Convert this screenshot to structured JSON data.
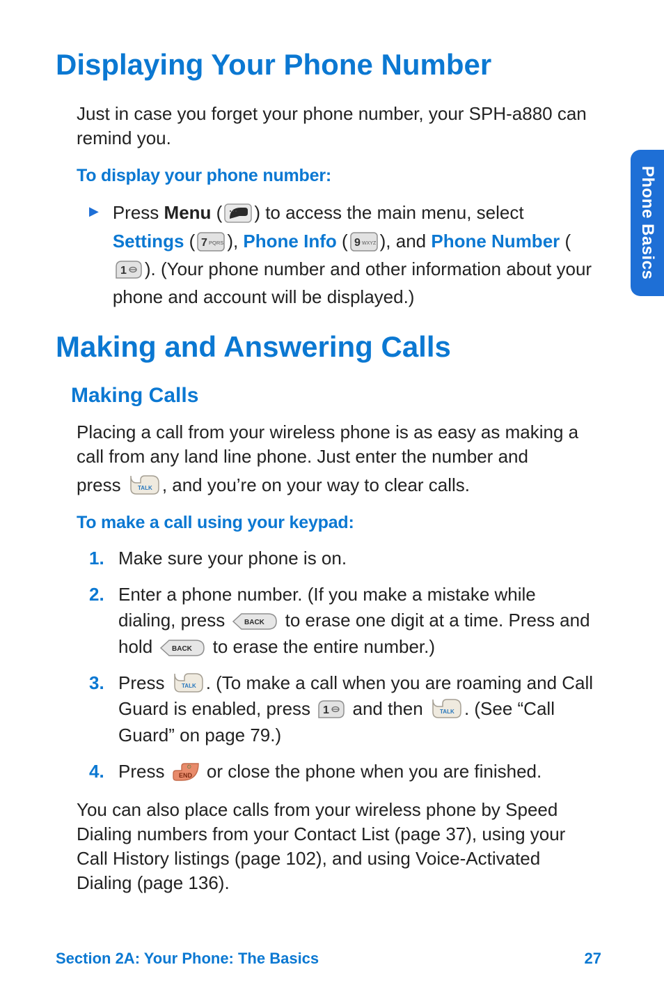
{
  "side_tab": "Phone Basics",
  "heading1a": "Displaying Your Phone Number",
  "para1": "Just in case you forget your phone number, your SPH-a880 can remind you.",
  "subhead1": "To display your phone number:",
  "bullet1": {
    "t1": "Press ",
    "menu": "Menu",
    "t2": " (",
    "t3": ") to access the main menu, select ",
    "settings": "Settings",
    "t4": " (",
    "t5": "), ",
    "phoneinfo": "Phone Info",
    "t6": " (",
    "t7": "), and ",
    "phonenum": "Phone Number",
    "t8": " (",
    "t9": "). (Your phone number and other information about your phone and account will be displayed.)"
  },
  "heading1b": "Making and Answering Calls",
  "heading2a": "Making Calls",
  "para2a": "Placing a call from your wireless phone is as easy as making a call from any land line phone. Just enter the number and",
  "para2b_a": "press ",
  "para2b_b": ", and you’re on your way to clear calls.",
  "subhead2": "To make a call using your keypad:",
  "ol": {
    "n1": "1.",
    "i1": "Make sure your phone is on.",
    "n2": "2.",
    "i2a": "Enter a phone number. (If you make a mistake while dialing, press ",
    "i2b": " to erase one digit at a time. Press and hold ",
    "i2c": " to erase the entire number.)",
    "n3": "3.",
    "i3a": "Press ",
    "i3b": ". (To make a call when you are roaming and Call Guard is enabled, press ",
    "i3c": " and then ",
    "i3d": ". (See “Call Guard” on page 79.)",
    "n4": "4.",
    "i4a": "Press ",
    "i4b": " or close the phone when you are finished."
  },
  "para3": "You can also place calls from your wireless phone by Speed Dialing numbers from your Contact List (page 37), using your Call History listings (page 102), and using Voice-Activated Dialing (page 136).",
  "footer_left": "Section 2A: Your Phone: The Basics",
  "footer_right": "27"
}
